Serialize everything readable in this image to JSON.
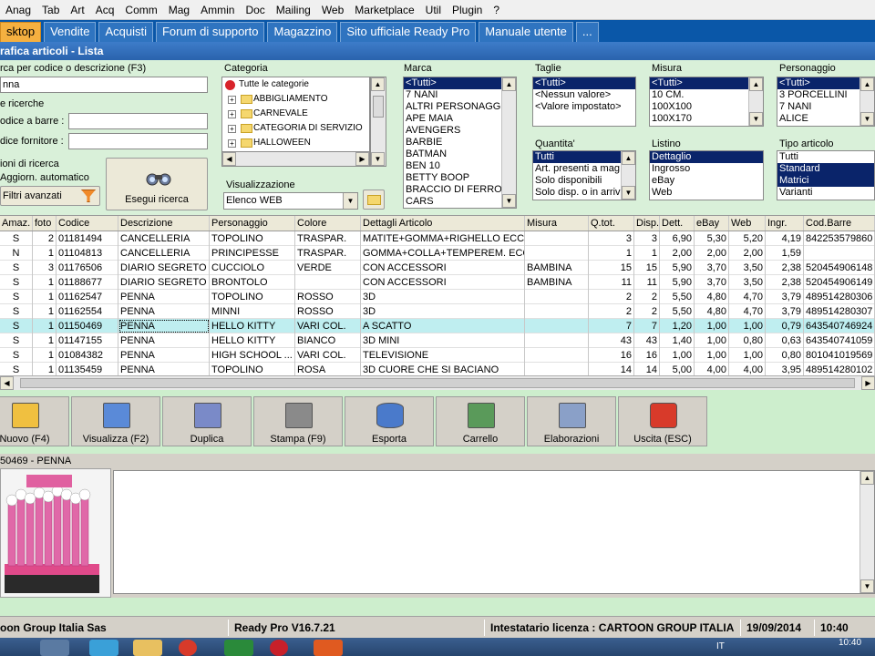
{
  "menu": [
    "Anag",
    "Tab",
    "Art",
    "Acq",
    "Comm",
    "Mag",
    "Ammin",
    "Doc",
    "Mailing",
    "Web",
    "Marketplace",
    "Util",
    "Plugin",
    "?"
  ],
  "tabs": [
    {
      "label": "sktop",
      "active": true
    },
    {
      "label": "Vendite",
      "active": false
    },
    {
      "label": "Acquisti",
      "active": false
    },
    {
      "label": "Forum di supporto",
      "active": false
    },
    {
      "label": "Magazzino",
      "active": false
    },
    {
      "label": "Sito ufficiale Ready Pro",
      "active": false
    },
    {
      "label": "Manuale utente",
      "active": false
    },
    {
      "label": "...",
      "active": false
    }
  ],
  "window_title": "rafica articoli  - Lista",
  "search": {
    "label": "rca per codice o descrizione (F3)",
    "value": "nna",
    "other_label": "e ricerche",
    "barcode_label": "odice a barre :",
    "supplier_label": "dice fornitore :",
    "options_label": "ioni di ricerca",
    "auto_update": "Aggiorn. automatico",
    "advanced": "Filtri avanzati",
    "run": "Esegui ricerca"
  },
  "categoria": {
    "label": "Categoria",
    "root": "Tutte le categorie",
    "items": [
      "ABBIGLIAMENTO",
      "CARNEVALE",
      "CATEGORIA DI SERVIZIO",
      "HALLOWEEN"
    ]
  },
  "visualizzazione": {
    "label": "Visualizzazione",
    "value": "Elenco WEB"
  },
  "marca": {
    "label": "Marca",
    "items": [
      "<Tutti>",
      "7 NANI",
      "ALTRI PERSONAGGI",
      "APE MAIA",
      "AVENGERS",
      "BARBIE",
      "BATMAN",
      "BEN 10",
      "BETTY BOOP",
      "BRACCIO DI FERRO",
      "CARS"
    ]
  },
  "taglie": {
    "label": "Taglie",
    "items": [
      "<Tutti>",
      "<Nessun valore>",
      "<Valore impostato>"
    ]
  },
  "misura": {
    "label": "Misura",
    "items": [
      "<Tutti>",
      "10 CM.",
      "100X100",
      "100X170"
    ]
  },
  "personaggio": {
    "label": "Personaggio",
    "items": [
      "<Tutti>",
      "3 PORCELLINI",
      "7 NANI",
      "ALICE"
    ]
  },
  "quantita": {
    "label": "Quantita'",
    "items": [
      "Tutti",
      "Art. presenti a mag",
      "Solo disponibili",
      "Solo disp. o in arrivo"
    ]
  },
  "listino": {
    "label": "Listino",
    "items": [
      "Dettaglio",
      "Ingrosso",
      "eBay",
      "Web"
    ]
  },
  "tipo_articolo": {
    "label": "Tipo articolo",
    "items": [
      "Tutti",
      "Standard",
      "Matrici",
      "Varianti"
    ]
  },
  "grid": {
    "headers": [
      "Amaz.",
      "foto",
      "Codice",
      "Descrizione",
      "Personaggio",
      "Colore",
      "Dettagli Articolo",
      "Misura",
      "Q.tot.",
      "Disp.",
      "Dett.",
      "eBay",
      "Web",
      "Ingr.",
      "Cod.Barre"
    ],
    "rows": [
      [
        "S",
        "2",
        "01181494",
        "CANCELLERIA",
        "TOPOLINO",
        "TRASPAR.",
        "MATITE+GOMMA+RIGHELLO ECC",
        "",
        "3",
        "3",
        "6,90",
        "5,30",
        "5,20",
        "4,19",
        "842253579860"
      ],
      [
        "N",
        "1",
        "01104813",
        "CANCELLERIA",
        "PRINCIPESSE",
        "TRASPAR.",
        "GOMMA+COLLA+TEMPEREM. ECC",
        "",
        "1",
        "1",
        "2,00",
        "2,00",
        "2,00",
        "1,59",
        ""
      ],
      [
        "S",
        "3",
        "01176506",
        "DIARIO SEGRETO",
        "CUCCIOLO",
        "VERDE",
        "CON ACCESSORI",
        "BAMBINA",
        "15",
        "15",
        "5,90",
        "3,70",
        "3,50",
        "2,38",
        "520454906148"
      ],
      [
        "S",
        "1",
        "01188677",
        "DIARIO SEGRETO",
        "BRONTOLO",
        "",
        "CON ACCESSORI",
        "BAMBINA",
        "11",
        "11",
        "5,90",
        "3,70",
        "3,50",
        "2,38",
        "520454906149"
      ],
      [
        "S",
        "1",
        "01162547",
        "PENNA",
        "TOPOLINO",
        "ROSSO",
        "3D",
        "",
        "2",
        "2",
        "5,50",
        "4,80",
        "4,70",
        "3,79",
        "489514280306"
      ],
      [
        "S",
        "1",
        "01162554",
        "PENNA",
        "MINNI",
        "ROSSO",
        "3D",
        "",
        "2",
        "2",
        "5,50",
        "4,80",
        "4,70",
        "3,79",
        "489514280307"
      ],
      [
        "S",
        "1",
        "01150469",
        "PENNA",
        "HELLO KITTY",
        "VARI COL.",
        "A SCATTO",
        "",
        "7",
        "7",
        "1,20",
        "1,00",
        "1,00",
        "0,79",
        "643540746924"
      ],
      [
        "S",
        "1",
        "01147155",
        "PENNA",
        "HELLO KITTY",
        "BIANCO",
        "3D MINI",
        "",
        "43",
        "43",
        "1,40",
        "1,00",
        "0,80",
        "0,63",
        "643540741059"
      ],
      [
        "S",
        "1",
        "01084382",
        "PENNA",
        "HIGH SCHOOL ...",
        "VARI COL.",
        "TELEVISIONE",
        "",
        "16",
        "16",
        "1,00",
        "1,00",
        "1,00",
        "0,80",
        "801041019569"
      ],
      [
        "S",
        "1",
        "01135459",
        "PENNA",
        "TOPOLINO",
        "ROSA",
        "3D CUORE CHE SI BACIANO",
        "",
        "14",
        "14",
        "5,00",
        "4,00",
        "4,00",
        "3,95",
        "489514280102"
      ]
    ],
    "selected_row": 6
  },
  "toolbar": [
    "Nuovo (F4)",
    "Visualizza (F2)",
    "Duplica",
    "Stampa (F9)",
    "Esporta",
    "Carrello",
    "Elaborazioni",
    "Uscita (ESC)"
  ],
  "detail_label": "50469 - PENNA",
  "status": {
    "company": "oon Group Italia Sas",
    "version": "Ready Pro V16.7.21",
    "license": "Intestatario licenza : CARTOON GROUP ITALIA",
    "date": "19/09/2014",
    "time": "10:40"
  },
  "taskbar": {
    "lang": "IT",
    "clock": "10:40"
  },
  "colors": {
    "accent_tab": "#f5b040",
    "tab_bar": "#0a57a8",
    "panel_green": "#d9f0d9",
    "selection": "#0a246a",
    "row_highlight": "#bfeef0",
    "arrow": "#e00000"
  }
}
